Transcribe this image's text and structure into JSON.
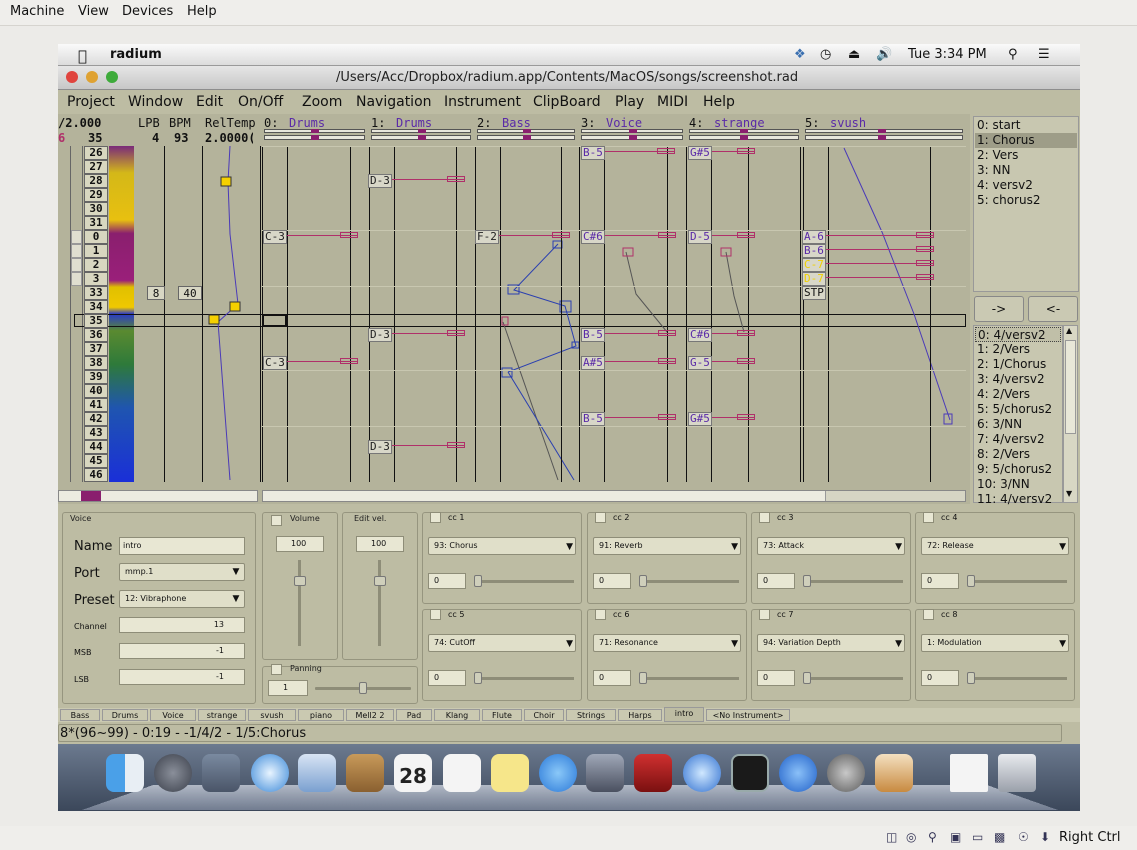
{
  "host_menu": [
    "Machine",
    "View",
    "Devices",
    "Help"
  ],
  "host_status_right": "Right Ctrl",
  "mac_menubar": {
    "app": "radium",
    "time": "Tue 3:34 PM"
  },
  "window_title": "/Users/Acc/Dropbox/radium.app/Contents/MacOS/songs/screenshot.rad",
  "app_menu": [
    "Project",
    "Window",
    "Edit",
    "On/Off",
    "Zoom",
    "Navigation",
    "Instrument",
    "ClipBoard",
    "Play",
    "MIDI",
    "Help"
  ],
  "editor": {
    "left_header": "/2.000",
    "left_sub": "6",
    "lpb_label": "LPB",
    "bpm_label": "BPM",
    "reltempo_label": "RelTemp",
    "lpb_value": "4",
    "bpm_value": "93",
    "reltempo_value": "2.0000(",
    "current_line": "35",
    "tracks": [
      {
        "num": "0:",
        "name": "Drums"
      },
      {
        "num": "1:",
        "name": "Drums"
      },
      {
        "num": "2:",
        "name": "Bass"
      },
      {
        "num": "3:",
        "name": "Voice"
      },
      {
        "num": "4:",
        "name": "strange"
      },
      {
        "num": "5:",
        "name": "svush"
      }
    ],
    "line_numbers": [
      "26",
      "27",
      "28",
      "29",
      "30",
      "31",
      "0",
      "1",
      "2",
      "3",
      "33",
      "34",
      "35",
      "36",
      "37",
      "38",
      "39",
      "40",
      "41",
      "42",
      "43",
      "44",
      "45",
      "46"
    ],
    "lpb_change": "8",
    "bpm_change": "40",
    "notes": [
      {
        "track": 3,
        "text": "B-5"
      },
      {
        "track": 4,
        "text": "G#5"
      },
      {
        "track": 1,
        "text": "D-3"
      },
      {
        "track": 0,
        "text": "C-3"
      },
      {
        "track": 2,
        "text": "F-2"
      },
      {
        "track": 3,
        "text": "C#6"
      },
      {
        "track": 4,
        "text": "D-5"
      },
      {
        "track": 5,
        "text": "A-6"
      },
      {
        "track": 5,
        "text": "B-6"
      },
      {
        "track": 5,
        "text": "C-7"
      },
      {
        "track": 5,
        "text": "D-7"
      },
      {
        "track": 5,
        "text": "STP"
      },
      {
        "track": 1,
        "text": "D-3"
      },
      {
        "track": 3,
        "text": "B-5"
      },
      {
        "track": 4,
        "text": "C#6"
      },
      {
        "track": 0,
        "text": "C-3"
      },
      {
        "track": 3,
        "text": "A#5"
      },
      {
        "track": 4,
        "text": "G-5"
      },
      {
        "track": 3,
        "text": "B-5"
      },
      {
        "track": 4,
        "text": "G#5"
      },
      {
        "track": 1,
        "text": "D-3"
      }
    ]
  },
  "block_list": [
    "0: start",
    "1: Chorus",
    "2: Vers",
    "3: NN",
    "4: versv2",
    "5: chorus2"
  ],
  "block_list_selected": 1,
  "playlist_buttons": [
    "->",
    "<-"
  ],
  "playlist": [
    "0: 4/versv2",
    "1: 2/Vers",
    "2: 1/Chorus",
    "3: 4/versv2",
    "4: 2/Vers",
    "5: 5/chorus2",
    "6: 3/NN",
    "7: 4/versv2",
    "8: 2/Vers",
    "9: 5/chorus2",
    "10: 3/NN",
    "11: 4/versv2"
  ],
  "instrument": {
    "group_label": "Voice",
    "name_label": "Name",
    "name_value": "intro",
    "port_label": "Port",
    "port_value": "mmp.1",
    "preset_label": "Preset",
    "preset_value": "12:  Vibraphone",
    "channel_label": "Channel",
    "channel_value": "13",
    "msb_label": "MSB",
    "msb_value": "-1",
    "lsb_label": "LSB",
    "lsb_value": "-1",
    "volume_label": "Volume",
    "volume_value": "100",
    "editvel_label": "Edit vel.",
    "editvel_value": "100",
    "panning_label": "Panning",
    "panning_value": "1"
  },
  "cc": [
    {
      "label": "cc 1",
      "value": "93: Chorus",
      "num": "0"
    },
    {
      "label": "cc 2",
      "value": "91: Reverb",
      "num": "0"
    },
    {
      "label": "cc 3",
      "value": "73: Attack",
      "num": "0"
    },
    {
      "label": "cc 4",
      "value": "72: Release",
      "num": "0"
    },
    {
      "label": "cc 5",
      "value": "74: CutOff",
      "num": "0"
    },
    {
      "label": "cc 6",
      "value": "71: Resonance",
      "num": "0"
    },
    {
      "label": "cc 7",
      "value": "94: Variation Depth",
      "num": "0"
    },
    {
      "label": "cc 8",
      "value": "1: Modulation",
      "num": "0"
    }
  ],
  "instrument_tabs": [
    "Bass",
    "Drums",
    "Voice",
    "strange",
    "svush",
    "piano",
    "Mell2 2",
    "Pad",
    "Klang",
    "Flute",
    "Choir",
    "Strings",
    "Harps",
    "intro",
    "<No Instrument>"
  ],
  "status_text": "8*(96~99) - 0:19 - -1/4/2 - 1/5:Chorus",
  "colors": {
    "note_name": "#5a2aa8",
    "velocity": "#b0306a",
    "pitch_line": "#2a3fb0",
    "editor_bg": "#b4b39b",
    "panel_bg": "#bdbca3"
  }
}
